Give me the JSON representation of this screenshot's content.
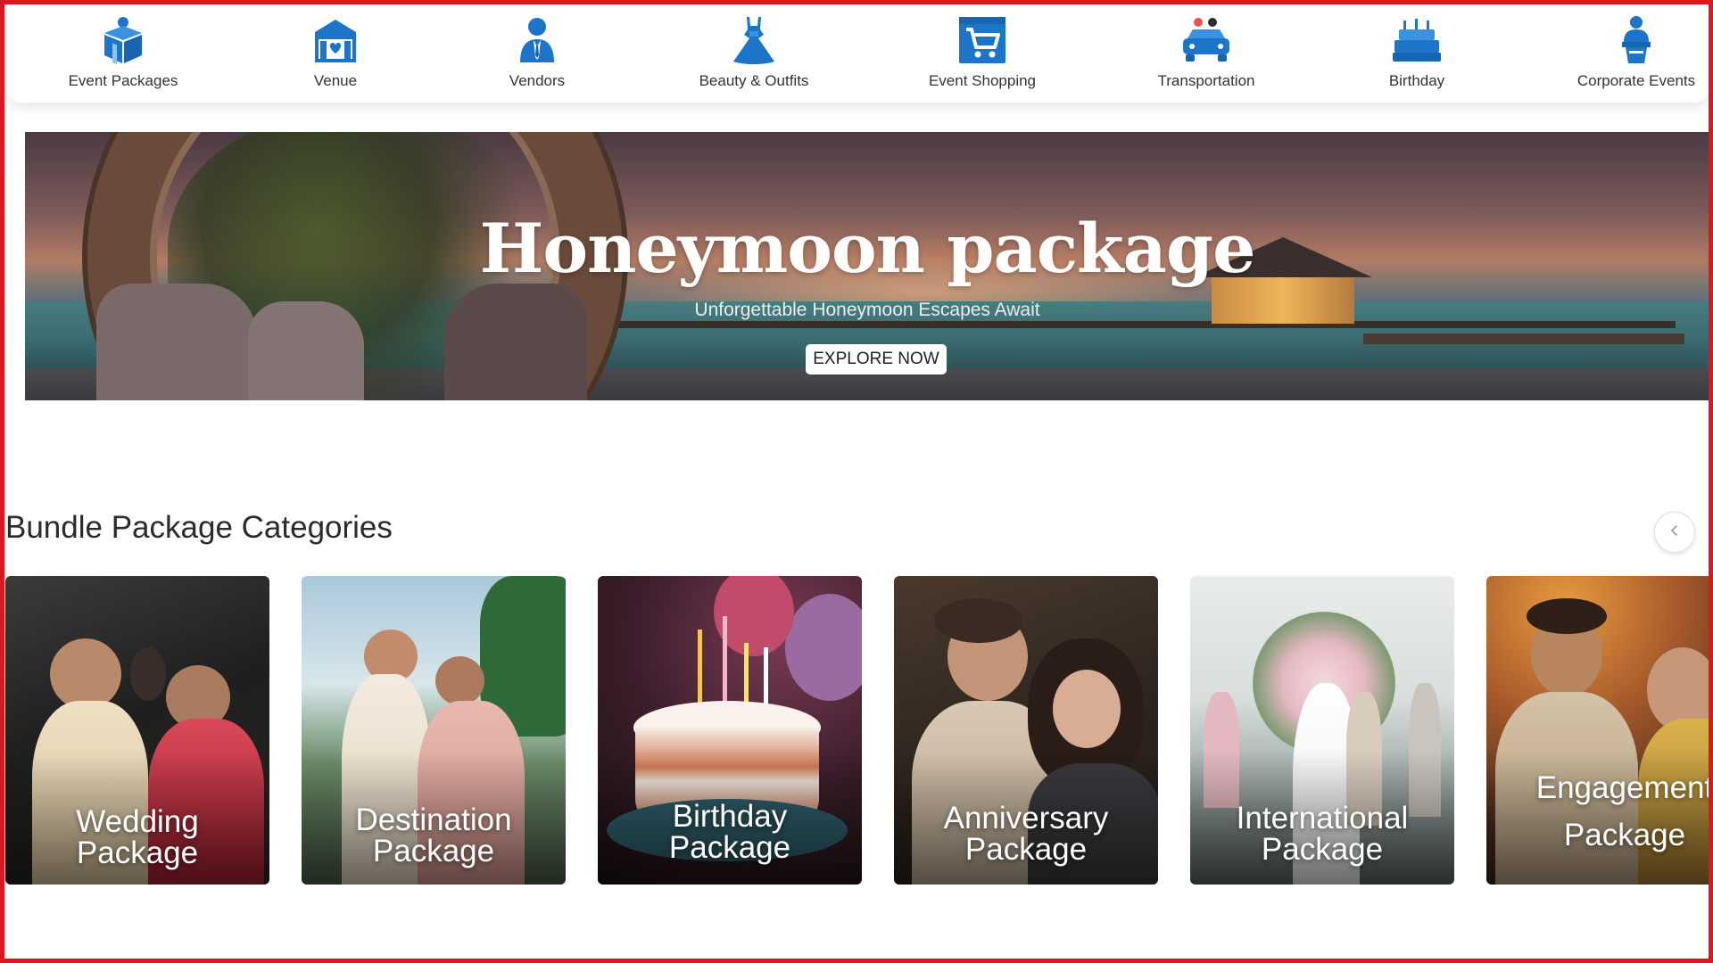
{
  "nav": {
    "items": [
      {
        "label": "Event Packages",
        "icon": "gift-box-icon"
      },
      {
        "label": "Venue",
        "icon": "venue-icon"
      },
      {
        "label": "Vendors",
        "icon": "vendor-person-icon"
      },
      {
        "label": "Beauty & Outfits",
        "icon": "dress-icon"
      },
      {
        "label": "Event Shopping",
        "icon": "shopping-cart-icon"
      },
      {
        "label": "Transportation",
        "icon": "car-icon"
      },
      {
        "label": "Birthday",
        "icon": "cake-icon"
      },
      {
        "label": "Corporate Events",
        "icon": "podium-speaker-icon"
      }
    ]
  },
  "banner": {
    "title": "Honeymoon package",
    "subtitle": "Unforgettable Honeymoon Escapes Await",
    "cta": "EXPLORE NOW"
  },
  "bundles": {
    "title": "Bundle Package Categories",
    "prev_icon": "chevron-left-icon",
    "cards": [
      {
        "line1": "Wedding",
        "line2": "Package"
      },
      {
        "line1": "Destination",
        "line2": "Package"
      },
      {
        "line1": "Birthday",
        "line2": "Package"
      },
      {
        "line1": "Anniversary",
        "line2": "Package"
      },
      {
        "line1": "International",
        "line2": "Package"
      },
      {
        "line1": "Engagement",
        "line2": "Package"
      }
    ]
  },
  "colors": {
    "icon_blue": "#1d75c9",
    "frame_red": "#d9181f",
    "text_dark": "#2b2b2b"
  }
}
